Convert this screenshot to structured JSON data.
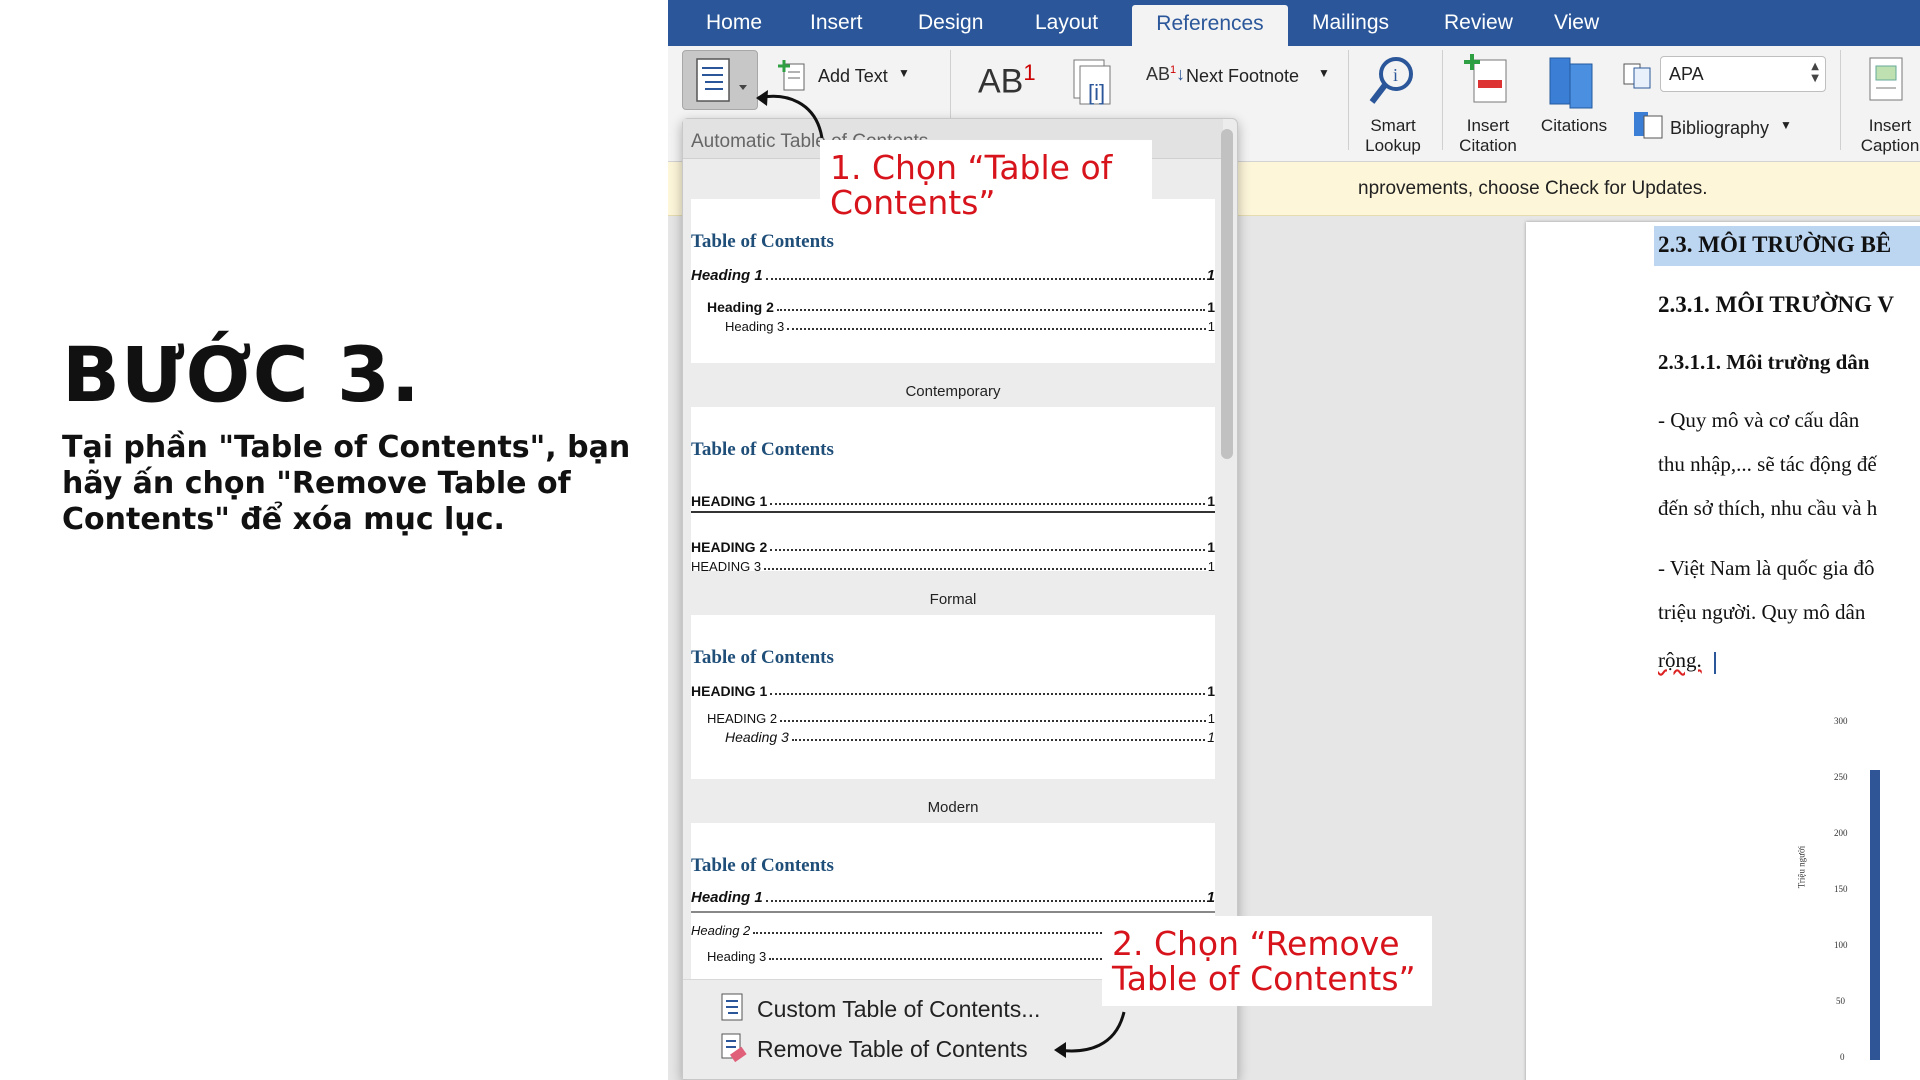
{
  "step": {
    "title": "BƯỚC 3.",
    "description": "Tại phần \"Table of Contents\", bạn hãy ấn chọn \"Remove Table of Contents\" để xóa mục lục."
  },
  "tabs": [
    "Home",
    "Insert",
    "Design",
    "Layout",
    "References",
    "Mailings",
    "Review",
    "View"
  ],
  "active_tab": "References",
  "ribbon": {
    "add_text": "Add Text",
    "next_footnote": "Next Footnote",
    "smart_lookup": [
      "Smart",
      "Lookup"
    ],
    "insert_citation": [
      "Insert",
      "Citation"
    ],
    "citations": "Citations",
    "style_value": "APA",
    "bibliography": "Bibliography",
    "insert_caption": [
      "Insert",
      "Caption"
    ]
  },
  "notice": "nprovements, choose Check for Updates.",
  "document": {
    "h1": "2.3. MÔI TRƯỜNG BÊ",
    "h2": "2.3.1. MÔI TRƯỜNG V",
    "h3": "2.3.1.1. Môi trường dân",
    "lines": [
      "- Quy mô và cơ cấu dân",
      "thu nhập,... sẽ tác động đế",
      "đến sở thích, nhu cầu và h",
      "- Việt Nam là quốc gia đô",
      "triệu người. Quy mô dân",
      "rộng."
    ],
    "chart_ylabel": "Triệu người",
    "chart_ticks": [
      "300",
      "250",
      "200",
      "150",
      "100",
      "50",
      "0"
    ]
  },
  "dropdown": {
    "header": "Automatic Table of Contents",
    "toc_title": "Table of Contents",
    "styles": [
      {
        "label": "",
        "h1": "Heading 1",
        "h2": "Heading 2",
        "h3": "Heading 3"
      },
      {
        "label": "Contemporary",
        "h1": "HEADING 1",
        "h2": "HEADING 2",
        "h3": "HEADING 3"
      },
      {
        "label": "Formal",
        "h1": "HEADING 1",
        "h2": "HEADING 2",
        "h3": "Heading 3"
      },
      {
        "label": "Modern",
        "h1": "Heading 1",
        "h2": "Heading 2",
        "h3": "Heading 3"
      }
    ],
    "page_num": "1",
    "custom_item": "Custom Table of Contents...",
    "remove_item": "Remove Table of Contents"
  },
  "callouts": {
    "one": "1. Chọn “Table of Contents”",
    "two": "2. Chọn “Remove Table of Contents”"
  },
  "colors": {
    "tabbar": "#2b579a",
    "callout_text": "#d7131b",
    "toc_title": "#1f4e79"
  }
}
